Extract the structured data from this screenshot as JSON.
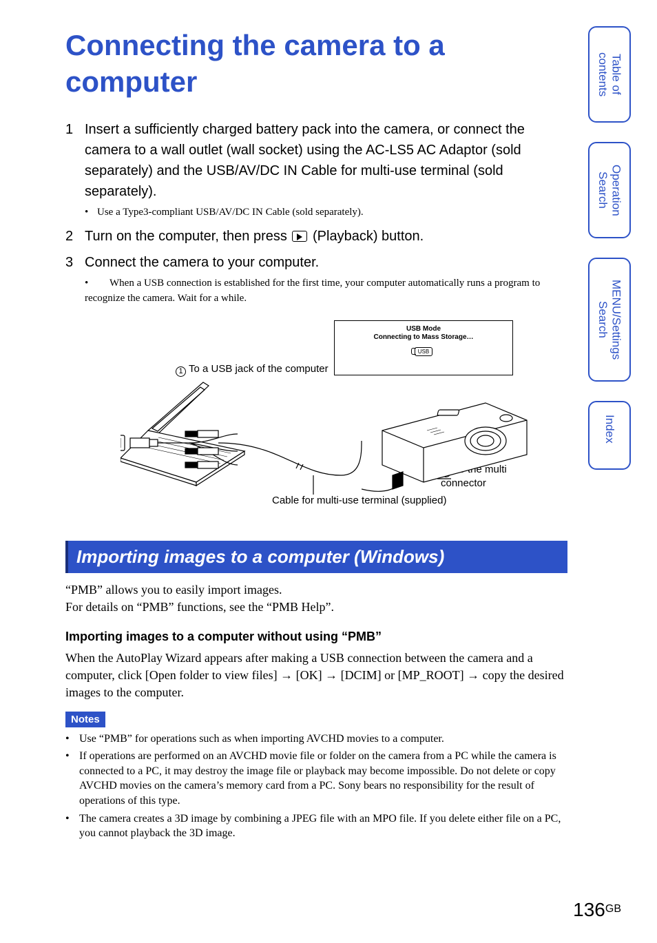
{
  "title": "Connecting the camera to a computer",
  "steps": [
    {
      "num": "1",
      "text": "Insert a sufficiently charged battery pack into the camera, or connect the camera to a wall outlet (wall socket) using the AC-LS5 AC Adaptor (sold separately) and the USB/AV/DC IN Cable for multi-use terminal (sold separately).",
      "sub": "Use a Type3-compliant USB/AV/DC IN Cable (sold separately)."
    },
    {
      "num": "2",
      "text_before": "Turn on the computer, then press ",
      "text_after": " (Playback) button."
    },
    {
      "num": "3",
      "text": "Connect the camera to your computer.",
      "sub": "When a USB connection is established for the first time, your computer automatically runs a program to recognize the camera. Wait for a while."
    }
  ],
  "diagram": {
    "screen_line1": "USB Mode",
    "screen_line2": "Connecting to Mass Storage…",
    "usb_label": "USB",
    "callout1": "To a USB jack of the computer",
    "callout2": "To the multi connector",
    "cable_label": "Cable for multi-use terminal (supplied)"
  },
  "section": {
    "heading": "Importing images to a computer (Windows)",
    "intro1": "“PMB” allows you to easily import images.",
    "intro2": "For details on “PMB” functions, see the “PMB Help”.",
    "subheading": "Importing images to a computer without using “PMB”",
    "body": "When the AutoPlay Wizard appears after making a USB connection between the camera and a computer, click [Open folder to view files] → [OK] → [DCIM] or [MP_ROOT] → copy the desired images to the computer."
  },
  "notes": {
    "label": "Notes",
    "items": [
      "Use “PMB” for operations such as when importing AVCHD movies to a computer.",
      "If operations are performed on an AVCHD movie file or folder on the camera from a PC while the camera is connected to a PC, it may destroy the image file or playback may become impossible. Do not delete or copy AVCHD movies on the camera’s memory card from a PC. Sony bears no responsibility for the result of operations of this type.",
      "The camera creates a 3D image by combining a JPEG file with an MPO file. If you delete either file on a PC, you cannot playback the 3D image."
    ]
  },
  "pagenum": {
    "num": "136",
    "suffix": "GB"
  },
  "tabs": [
    "Table of contents",
    "Operation Search",
    "MENU/Settings Search",
    "Index"
  ]
}
